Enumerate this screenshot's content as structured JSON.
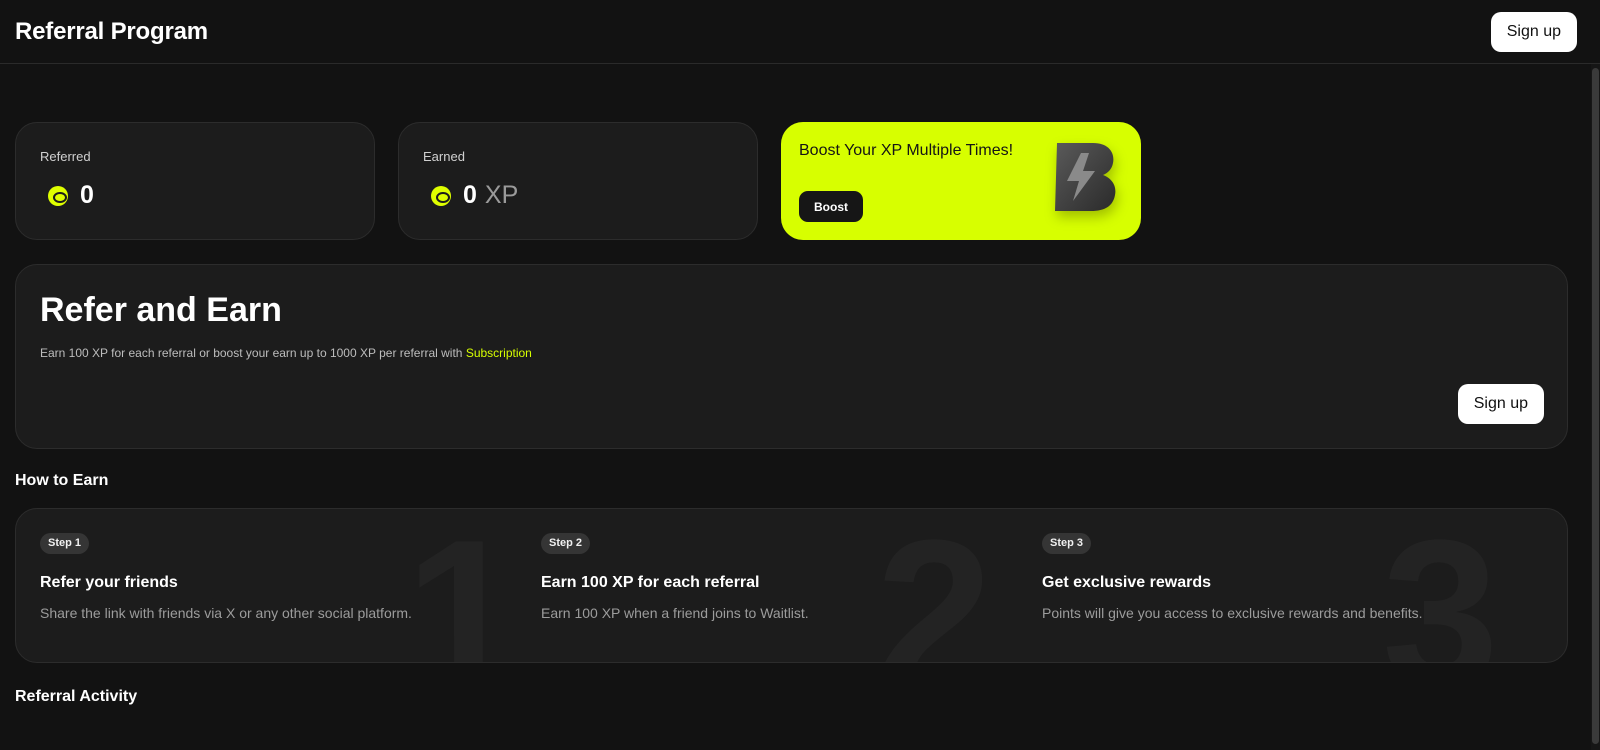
{
  "header": {
    "title": "Referral Program",
    "signup_label": "Sign up"
  },
  "stats": {
    "referred": {
      "label": "Referred",
      "value": "0"
    },
    "earned": {
      "label": "Earned",
      "value": "0",
      "unit": "XP"
    }
  },
  "boost": {
    "title": "Boost Your XP Multiple Times!",
    "button_label": "Boost",
    "logo_letter": "B"
  },
  "refer": {
    "title": "Refer and Earn",
    "description": "Earn 100 XP for each referral or boost your earn up to 1000 XP per referral with",
    "link_label": "Subscription",
    "signup_label": "Sign up"
  },
  "how_to_earn": {
    "heading": "How to Earn",
    "steps": [
      {
        "badge": "Step 1",
        "numeral": "1",
        "title": "Refer your friends",
        "description": "Share the link with friends via X or any other social platform."
      },
      {
        "badge": "Step 2",
        "numeral": "2",
        "title": "Earn 100 XP for each referral",
        "description": "Earn 100 XP when a friend joins to Waitlist."
      },
      {
        "badge": "Step 3",
        "numeral": "3",
        "title": "Get exclusive rewards",
        "description": "Points will give you access to exclusive rewards and benefits."
      }
    ]
  },
  "activity": {
    "heading": "Referral Activity"
  },
  "colors": {
    "accent": "#d7ff00",
    "background": "#121212",
    "card": "#1c1c1c"
  }
}
